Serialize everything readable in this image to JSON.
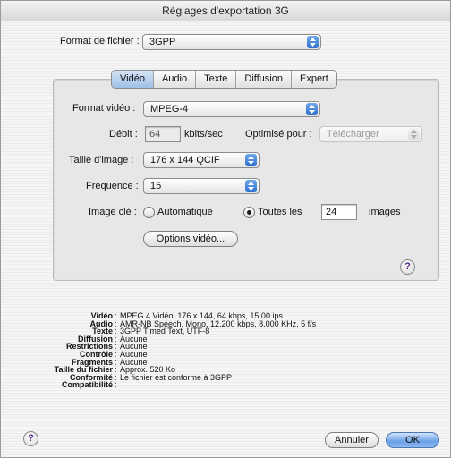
{
  "window": {
    "title": "Réglages d'exportation 3G"
  },
  "file_format": {
    "label": "Format de fichier :",
    "value": "3GPP"
  },
  "tabs": [
    {
      "label": "Vidéo",
      "active": true
    },
    {
      "label": "Audio",
      "active": false
    },
    {
      "label": "Texte",
      "active": false
    },
    {
      "label": "Diffusion",
      "active": false
    },
    {
      "label": "Expert",
      "active": false
    }
  ],
  "video": {
    "format_label": "Format vidéo :",
    "format_value": "MPEG-4",
    "bitrate_label": "Débit :",
    "bitrate_value": "64",
    "bitrate_unit": "kbits/sec",
    "optimize_label": "Optimisé pour :",
    "optimize_value": "Télécharger",
    "size_label": "Taille d'image :",
    "size_value": "176 x 144 QCIF",
    "frequency_label": "Fréquence :",
    "frequency_value": "15",
    "keyframe_label": "Image clé :",
    "keyframe_auto": "Automatique",
    "keyframe_every": "Toutes les",
    "keyframe_every_value": "24",
    "keyframe_images": "images",
    "options_button": "Options vidéo..."
  },
  "summary": [
    {
      "key": "Vidéo",
      "value": "MPEG 4 Vidéo, 176 x 144, 64 kbps, 15,00 ips"
    },
    {
      "key": "Audio",
      "value": "AMR-NB Speech, Mono, 12.200 kbps, 8.000 KHz, 5 f/s"
    },
    {
      "key": "Texte",
      "value": "3GPP Timed Text, UTF-8"
    },
    {
      "key": "Diffusion",
      "value": "Aucune"
    },
    {
      "key": "Restrictions",
      "value": "Aucune"
    },
    {
      "key": "Contrôle",
      "value": "Aucune"
    },
    {
      "key": "Fragments",
      "value": "Aucune"
    },
    {
      "key": "Taille du fichier",
      "value": "Approx. 520 Ko"
    },
    {
      "key": "Conformité",
      "value": "Le fichier est conforme à 3GPP"
    },
    {
      "key": "Compatibilité",
      "value": ""
    }
  ],
  "buttons": {
    "cancel": "Annuler",
    "ok": "OK",
    "help": "?"
  },
  "icons": {
    "popup": "updown-arrows-icon",
    "help": "help-icon"
  }
}
